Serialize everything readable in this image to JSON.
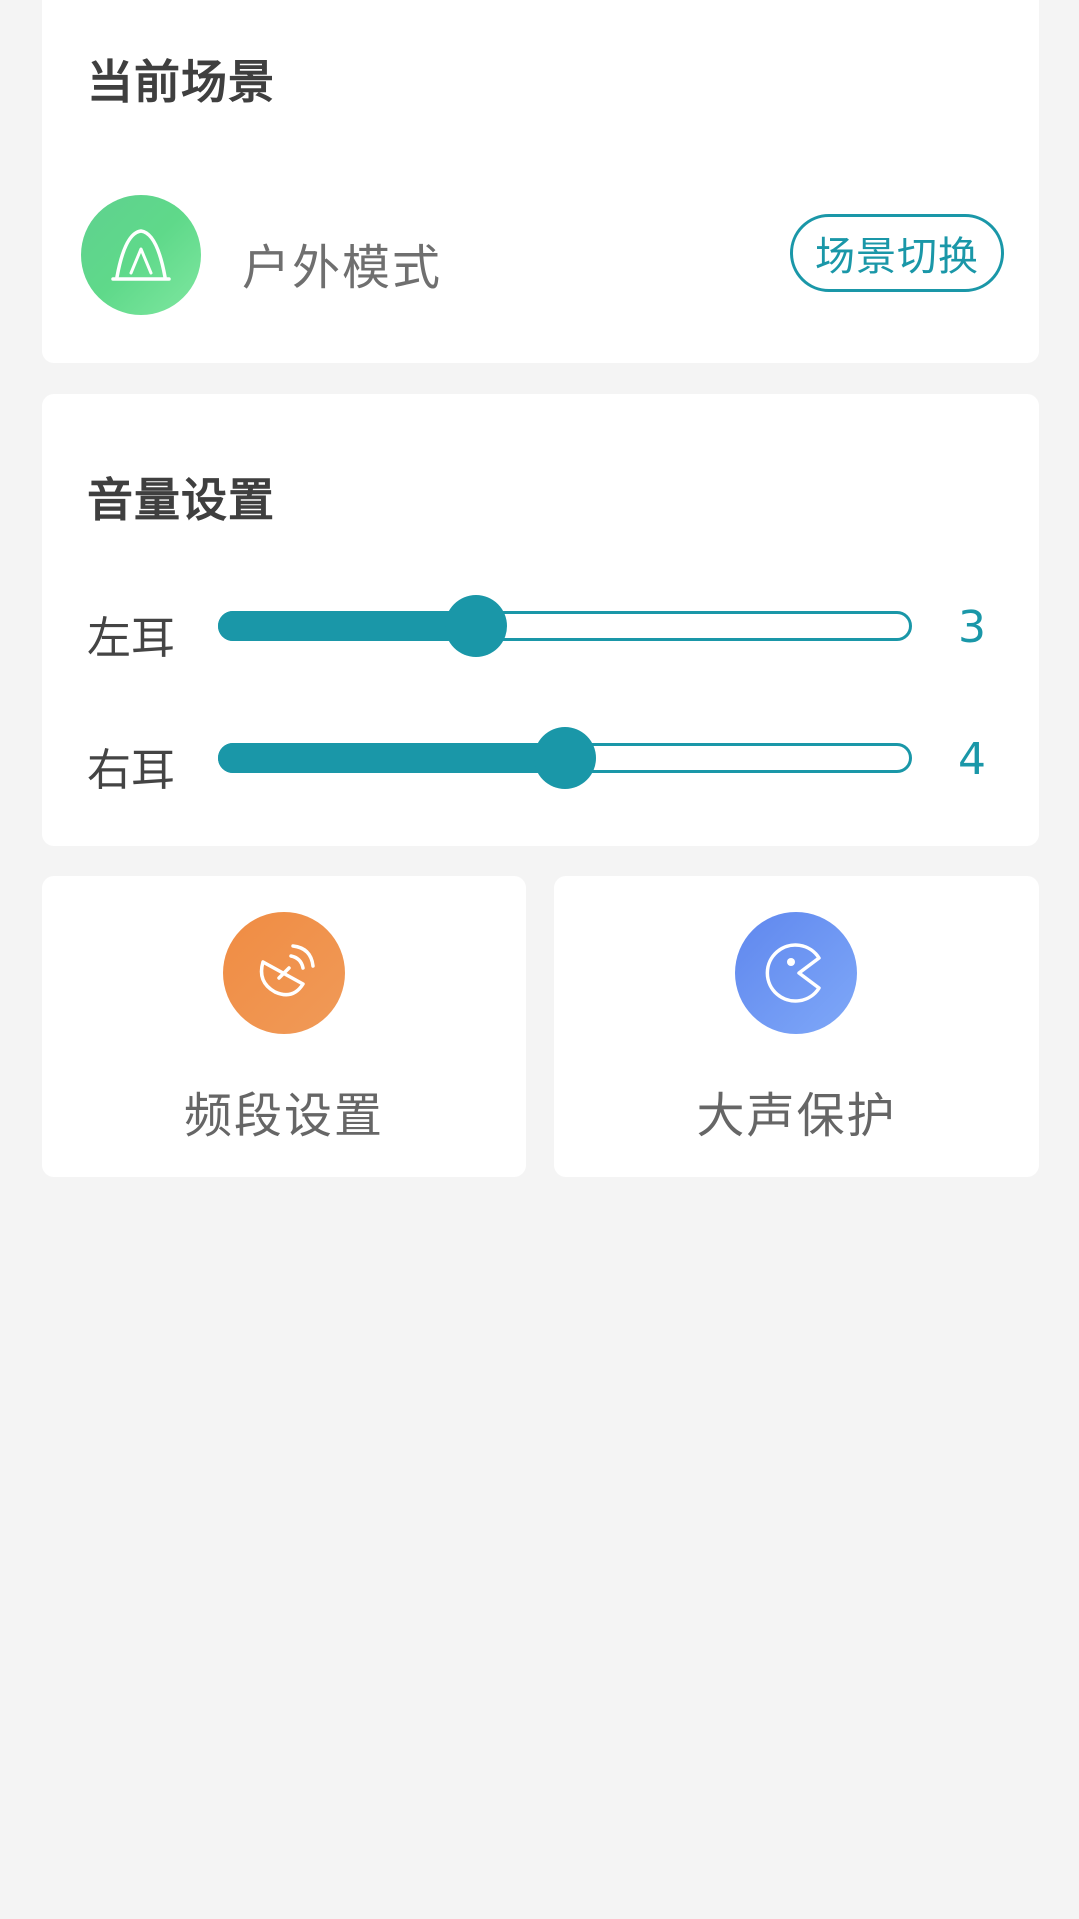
{
  "scene": {
    "title": "当前场景",
    "current_mode": "户外模式",
    "mode_icon": "tent-icon",
    "switch_label": "场景切换"
  },
  "volume": {
    "title": "音量设置",
    "left": {
      "label": "左耳",
      "value": "3",
      "fraction": 0.37
    },
    "right": {
      "label": "右耳",
      "value": "4",
      "fraction": 0.5
    }
  },
  "features": [
    {
      "label": "频段设置",
      "icon": "satellite-dish-icon"
    },
    {
      "label": "大声保护",
      "icon": "pacman-icon"
    }
  ],
  "colors": {
    "accent": "#1a97a8",
    "scene_icon": "#5fd18f",
    "band_icon": "#ef9148",
    "loud_icon": "#6d95f2",
    "background": "#f4f4f4"
  }
}
